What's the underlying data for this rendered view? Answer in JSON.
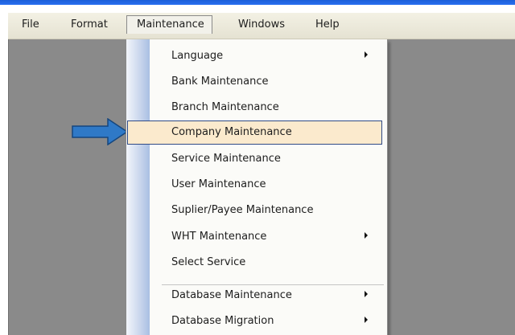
{
  "menubar": {
    "items": [
      "File",
      "Format",
      "Maintenance",
      "Windows",
      "Help"
    ]
  },
  "maintenance_menu": {
    "items": [
      {
        "label": "Language",
        "has_submenu": true
      },
      {
        "label": "Bank Maintenance",
        "has_submenu": false
      },
      {
        "label": "Branch Maintenance",
        "has_submenu": false
      },
      {
        "label": "Company Maintenance",
        "has_submenu": false,
        "highlighted": true
      },
      {
        "label": "Service Maintenance",
        "has_submenu": false
      },
      {
        "label": "User Maintenance",
        "has_submenu": false
      },
      {
        "label": "Suplier/Payee Maintenance",
        "has_submenu": false
      },
      {
        "label": "WHT Maintenance",
        "has_submenu": true
      },
      {
        "label": "Select Service",
        "has_submenu": false
      },
      {
        "label": "Database Maintenance",
        "has_submenu": true
      },
      {
        "label": "Database Migration",
        "has_submenu": true
      }
    ]
  },
  "colors": {
    "title_strip": "#1c5fd8",
    "client_area": "#8a8a8a",
    "highlight_fill": "#fbeacd",
    "highlight_border": "#2f4a86",
    "pointer_arrow": "#2f79c7"
  },
  "icons": {
    "pointer": "right-arrow-icon",
    "submenu": "chevron-right-icon"
  }
}
